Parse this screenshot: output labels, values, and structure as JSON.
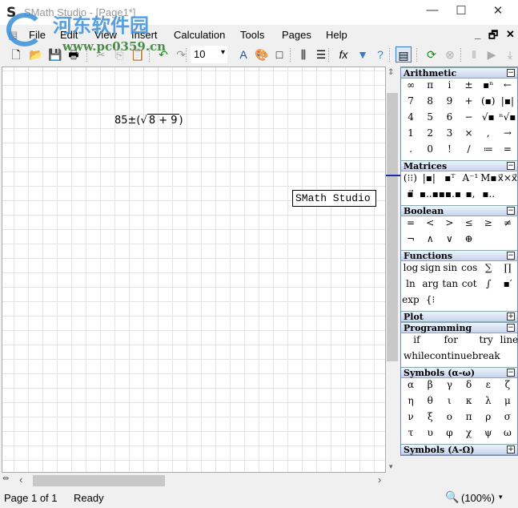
{
  "window": {
    "title": "SMath Studio - [Page1*]",
    "app_icon": "S",
    "minimize": "—",
    "maximize": "☐",
    "close": "✕"
  },
  "watermark": {
    "text": "河东软件园",
    "url": "www.pc0359.cn"
  },
  "menu": {
    "items": [
      "File",
      "Edit",
      "View",
      "Insert",
      "Calculation",
      "Tools",
      "Pages",
      "Help"
    ],
    "mdi_min": "_",
    "mdi_restore": "🗗",
    "mdi_close": "✕"
  },
  "toolbar": {
    "font_size": "10",
    "font_size_arrow": "▾",
    "icons": [
      [
        "new-page-icon",
        "🗋",
        12
      ],
      [
        "open-icon",
        "📂",
        37
      ],
      [
        "save-icon",
        "💾",
        61
      ],
      [
        "print-icon",
        "🖶",
        84
      ],
      [
        "cut-icon",
        "✂",
        118
      ],
      [
        "copy-icon",
        "⎘",
        141
      ],
      [
        "paste-icon",
        "📋",
        164
      ],
      [
        "undo-icon",
        "↶",
        196
      ],
      [
        "redo-icon",
        "↷",
        218
      ],
      [
        "text-color-icon",
        "A",
        296
      ],
      [
        "background-color-icon",
        "🎨",
        319
      ],
      [
        "border-icon",
        "□",
        341
      ],
      [
        "align-horizontal-icon",
        "⫼",
        371
      ],
      [
        "align-vertical-icon",
        "☰",
        393
      ],
      [
        "insert-function-icon",
        "fx",
        421
      ],
      [
        "filter-icon",
        "▼",
        445
      ],
      [
        "help-icon",
        "?",
        467
      ],
      [
        "panel-icon",
        "▤",
        496
      ],
      [
        "recalculate-icon",
        "⟳",
        531
      ],
      [
        "stop-icon",
        "⊗",
        554
      ],
      [
        "pause-icon",
        "‖",
        584
      ],
      [
        "play-icon",
        "▶",
        606
      ],
      [
        "step-icon",
        "⤓",
        629
      ]
    ]
  },
  "canvas": {
    "expression": {
      "left": "85±(",
      "radicand": "8 + 9",
      "right": ")"
    },
    "text_region": "SMath Studio"
  },
  "status": {
    "page": "Page 1 of 1",
    "state": "Ready",
    "zoom": "(100%)"
  },
  "panel": {
    "sections": [
      {
        "title": "Arithmetic",
        "toggle": "−",
        "type": "grid",
        "items": [
          "∞",
          "π",
          "i",
          "±",
          "▪ⁿ",
          "←",
          "7",
          "8",
          "9",
          "+",
          "(▪)",
          "|▪|",
          "4",
          "5",
          "6",
          "−",
          "√▪",
          "ⁿ√▪",
          "1",
          "2",
          "3",
          "×",
          ",",
          "→",
          ".",
          "0",
          "!",
          "/",
          "≔",
          "="
        ]
      },
      {
        "title": "Matrices",
        "toggle": "−",
        "type": "grid",
        "items": [
          "(⁝⁝)",
          "|▪|",
          "▪ᵀ",
          "A⁻¹",
          "M▪",
          "x⃗×x⃗",
          "▪⃗",
          "▪..▪",
          "▪▪.▪",
          "▪,",
          "▪.."
        ]
      },
      {
        "title": "Boolean",
        "toggle": "−",
        "type": "grid",
        "items": [
          "=",
          "<",
          ">",
          "≤",
          "≥",
          "≠",
          "¬",
          "∧",
          "∨",
          "⊕"
        ]
      },
      {
        "title": "Functions",
        "toggle": "−",
        "type": "grid",
        "items": [
          "log",
          "sign",
          "sin",
          "cos",
          "∑",
          "∏",
          "ln",
          "arg",
          "tan",
          "cot",
          "∫",
          "▪′",
          "exp",
          "{⁝"
        ]
      },
      {
        "title": "Plot",
        "toggle": "+",
        "type": "none",
        "items": []
      },
      {
        "title": "Programming",
        "toggle": "−",
        "type": "prog",
        "items": [
          "if",
          "for",
          "try",
          "line",
          "while",
          "continue",
          "break"
        ]
      },
      {
        "title": "Symbols (α-ω)",
        "toggle": "−",
        "type": "grid",
        "items": [
          "α",
          "β",
          "γ",
          "δ",
          "ε",
          "ζ",
          "η",
          "θ",
          "ι",
          "κ",
          "λ",
          "μ",
          "ν",
          "ξ",
          "ο",
          "π",
          "ρ",
          "σ",
          "τ",
          "υ",
          "φ",
          "χ",
          "ψ",
          "ω"
        ]
      },
      {
        "title": "Symbols (Α-Ω)",
        "toggle": "+",
        "type": "none",
        "items": []
      }
    ]
  }
}
